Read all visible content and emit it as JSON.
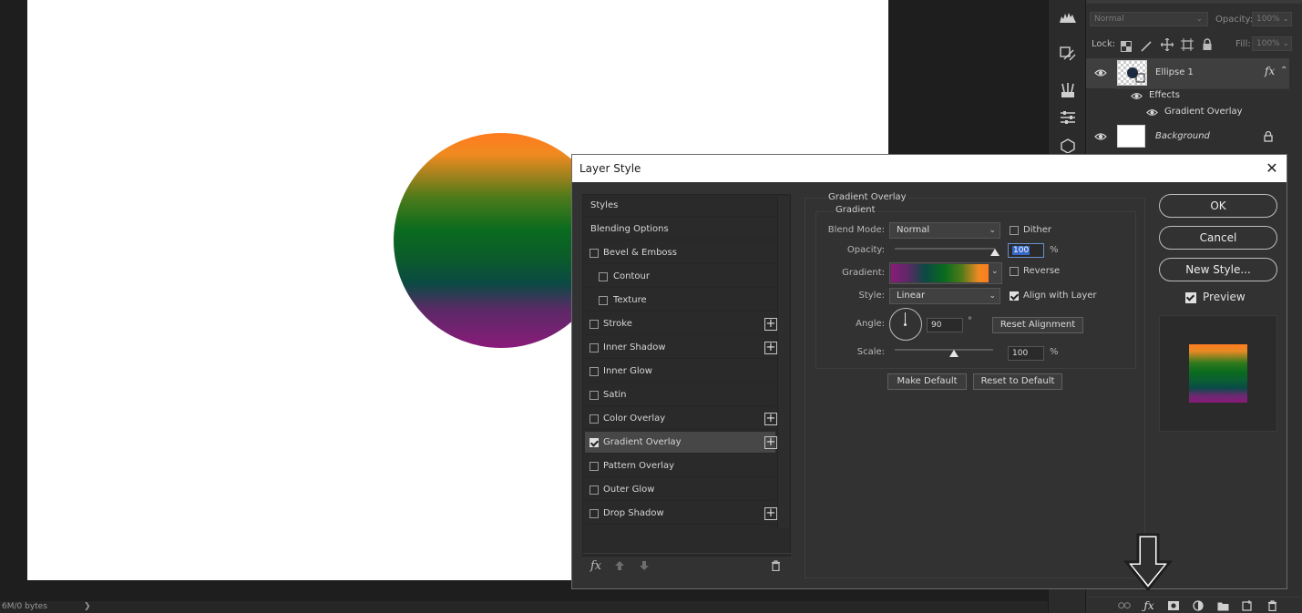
{
  "statusbar": {
    "text": "6M/0 bytes",
    "arrow": "❯"
  },
  "layers_panel": {
    "blend_mode": "Normal",
    "opacity_label": "Opacity:",
    "opacity_value": "100%",
    "lock_label": "Lock:",
    "fill_label": "Fill:",
    "fill_value": "100%",
    "layers": [
      {
        "name": "Ellipse 1",
        "fx": "fx"
      },
      {
        "name": "Effects"
      },
      {
        "name": "Gradient Overlay"
      },
      {
        "name": "Background"
      }
    ]
  },
  "dialog": {
    "title": "Layer Style",
    "close": "✕",
    "styles_list": [
      {
        "label": "Styles"
      },
      {
        "label": "Blending Options"
      },
      {
        "label": "Bevel & Emboss"
      },
      {
        "label": "Contour"
      },
      {
        "label": "Texture"
      },
      {
        "label": "Stroke"
      },
      {
        "label": "Inner Shadow"
      },
      {
        "label": "Inner Glow"
      },
      {
        "label": "Satin"
      },
      {
        "label": "Color Overlay"
      },
      {
        "label": "Gradient Overlay"
      },
      {
        "label": "Pattern Overlay"
      },
      {
        "label": "Outer Glow"
      },
      {
        "label": "Drop Shadow"
      }
    ],
    "footer_fx": "fx",
    "section_title": "Gradient Overlay",
    "group_title": "Gradient",
    "blend_mode_label": "Blend Mode:",
    "blend_mode_value": "Normal",
    "dither_label": "Dither",
    "opacity_label": "Opacity:",
    "opacity_value": "100",
    "percent": "%",
    "gradient_label": "Gradient:",
    "reverse_label": "Reverse",
    "style_label": "Style:",
    "style_value": "Linear",
    "align_label": "Align with Layer",
    "angle_label": "Angle:",
    "angle_value": "90",
    "degree": "°",
    "reset_alignment": "Reset Alignment",
    "scale_label": "Scale:",
    "scale_value": "100",
    "make_default": "Make Default",
    "reset_default": "Reset to Default",
    "ok": "OK",
    "cancel": "Cancel",
    "new_style": "New Style...",
    "preview_label": "Preview"
  },
  "state": {
    "opacity_fraction": 1.0,
    "scale_fraction": 0.6,
    "gradient_overlay_checked": true,
    "align_with_layer_checked": true,
    "preview_checked": true,
    "dither_checked": false,
    "reverse_checked": false
  },
  "colors": {
    "gradient_orange": "#ff7b1e",
    "gradient_green": "#0a6b1e",
    "gradient_purple": "#8a1a7a"
  }
}
